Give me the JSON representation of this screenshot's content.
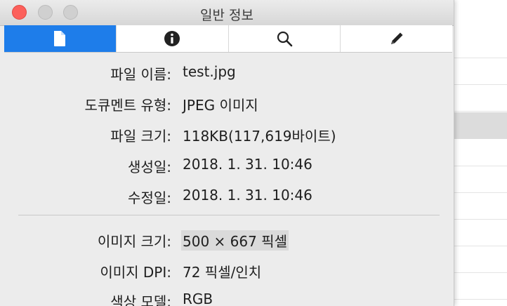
{
  "window": {
    "title": "일반 정보"
  },
  "tabs": [
    {
      "icon": "document-icon",
      "active": true
    },
    {
      "icon": "info-icon",
      "active": false
    },
    {
      "icon": "search-icon",
      "active": false
    },
    {
      "icon": "pencil-icon",
      "active": false
    }
  ],
  "general": {
    "file_name_label": "파일 이름:",
    "file_name_value": "test.jpg",
    "doc_type_label": "도큐멘트 유형:",
    "doc_type_value": "JPEG 이미지",
    "file_size_label": "파일 크기:",
    "file_size_value": "118KB(117,619바이트)",
    "created_label": "생성일:",
    "created_value": "2018. 1. 31. 10:46",
    "modified_label": "수정일:",
    "modified_value": "2018. 1. 31. 10:46"
  },
  "image": {
    "size_label": "이미지 크기:",
    "size_value": "500 × 667 픽셀",
    "dpi_label": "이미지 DPI:",
    "dpi_value": "72 픽셀/인치",
    "color_model_label": "색상 모델:",
    "color_model_value": "RGB"
  },
  "colors": {
    "tab_active": "#1e7dea",
    "close_button": "#fc605b",
    "panel_bg": "#ececec"
  }
}
